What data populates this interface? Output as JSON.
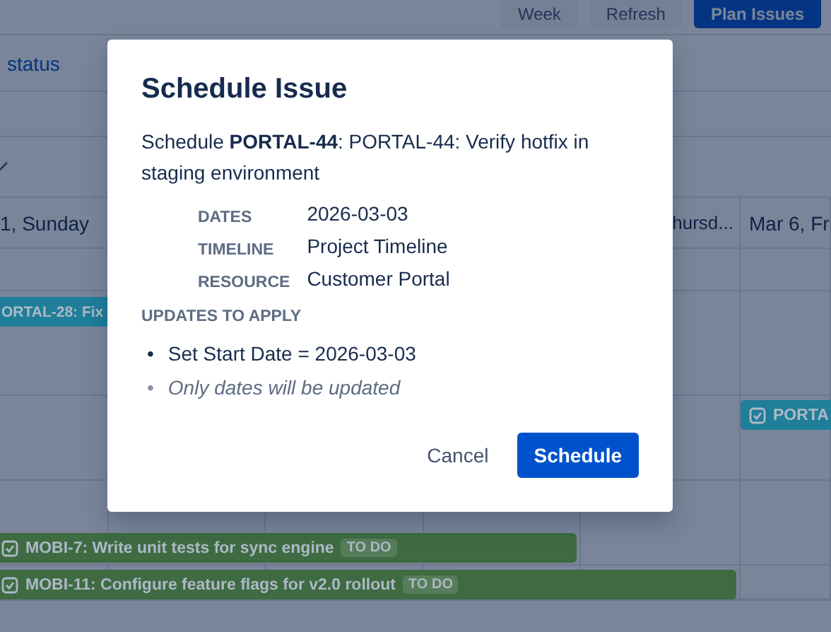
{
  "toolbar": {
    "buttons": [
      {
        "label": "Week",
        "kind": "plain"
      },
      {
        "label": "Refresh",
        "kind": "plain"
      },
      {
        "label": "Plan Issues",
        "kind": "primary"
      }
    ]
  },
  "filter_link": "status",
  "header_row": {
    "columns": [
      "1, Sunday",
      "",
      "",
      "",
      "hursd...",
      "Mar 6, Fr"
    ]
  },
  "bars": [
    {
      "label": "ORTAL-28: Fix",
      "color": "#1f7e99"
    },
    {
      "label": "PORTA",
      "color": "#1f7e99",
      "checkbox": true
    },
    {
      "label": "MOBI-7: Write unit tests for sync engine",
      "color": "#3e6b42",
      "checkbox": true,
      "tag": "TO DO"
    },
    {
      "label": "MOBI-11: Configure feature flags for v2.0 rollout",
      "color": "#3e6b42",
      "checkbox": true,
      "tag": "TO DO"
    }
  ],
  "dialog": {
    "title": "Schedule Issue",
    "intro": "Schedule **PORTAL-44**: PORTAL-44: Verify hotfix in staging environment",
    "fields": [
      {
        "label": "DATES",
        "value": "2026-03-03"
      },
      {
        "label": "TIMELINE",
        "value": "Project Timeline"
      },
      {
        "label": "RESOURCE",
        "value": "Customer Portal"
      }
    ],
    "updates_heading": "UPDATES TO APPLY",
    "updates": [
      {
        "marker": "•",
        "text": "Set Start Date = 2026-03-03",
        "kind": "change"
      },
      {
        "marker": "•",
        "text": "Only dates will be updated",
        "kind": "note"
      }
    ],
    "buttons": [
      {
        "label": "Cancel",
        "kind": "subtle"
      },
      {
        "label": "Schedule",
        "kind": "primary"
      }
    ]
  }
}
